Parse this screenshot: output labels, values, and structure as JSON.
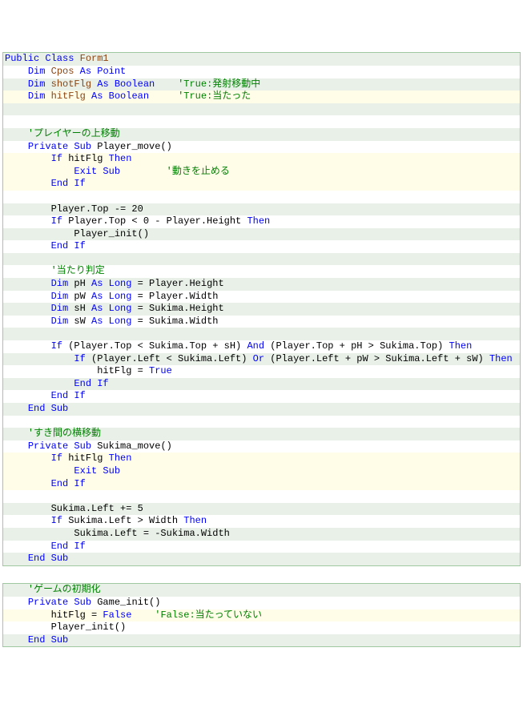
{
  "block1": {
    "lines": [
      {
        "spans": [
          {
            "t": "Public Class",
            "c": "kw"
          },
          {
            "t": " ",
            "c": "ident"
          },
          {
            "t": "Form1",
            "c": "var"
          }
        ]
      },
      {
        "spans": [
          {
            "t": "    ",
            "c": "ident"
          },
          {
            "t": "Dim",
            "c": "kw"
          },
          {
            "t": " ",
            "c": "ident"
          },
          {
            "t": "Cpos",
            "c": "var"
          },
          {
            "t": " ",
            "c": "ident"
          },
          {
            "t": "As",
            "c": "kw"
          },
          {
            "t": " ",
            "c": "ident"
          },
          {
            "t": "Point",
            "c": "kw"
          }
        ]
      },
      {
        "spans": [
          {
            "t": "    ",
            "c": "ident"
          },
          {
            "t": "Dim",
            "c": "kw"
          },
          {
            "t": " ",
            "c": "ident"
          },
          {
            "t": "shotFlg",
            "c": "var"
          },
          {
            "t": " ",
            "c": "ident"
          },
          {
            "t": "As Boolean",
            "c": "kw"
          },
          {
            "t": "    ",
            "c": "ident"
          },
          {
            "t": "'True:発射移動中",
            "c": "comment"
          }
        ]
      },
      {
        "highlight": true,
        "spans": [
          {
            "t": "    ",
            "c": "ident"
          },
          {
            "t": "Dim",
            "c": "kw"
          },
          {
            "t": " ",
            "c": "ident"
          },
          {
            "t": "hitFlg",
            "c": "var"
          },
          {
            "t": " ",
            "c": "ident"
          },
          {
            "t": "As Boolean",
            "c": "kw"
          },
          {
            "t": "     ",
            "c": "ident"
          },
          {
            "t": "'True:当たった",
            "c": "comment"
          }
        ]
      },
      {
        "spans": [
          {
            "t": " ",
            "c": "ident"
          }
        ]
      },
      {
        "spans": [
          {
            "t": " ",
            "c": "ident"
          }
        ]
      },
      {
        "spans": [
          {
            "t": "    ",
            "c": "ident"
          },
          {
            "t": "'プレイヤーの上移動",
            "c": "comment"
          }
        ]
      },
      {
        "spans": [
          {
            "t": "    ",
            "c": "ident"
          },
          {
            "t": "Private Sub",
            "c": "kw"
          },
          {
            "t": " Player_move()",
            "c": "ident"
          }
        ]
      },
      {
        "highlight": true,
        "spans": [
          {
            "t": "        ",
            "c": "ident"
          },
          {
            "t": "If",
            "c": "kw"
          },
          {
            "t": " hitFlg ",
            "c": "ident"
          },
          {
            "t": "Then",
            "c": "kw"
          }
        ]
      },
      {
        "highlight": true,
        "spans": [
          {
            "t": "            ",
            "c": "ident"
          },
          {
            "t": "Exit Sub",
            "c": "kw"
          },
          {
            "t": "        ",
            "c": "ident"
          },
          {
            "t": "'動きを止める",
            "c": "comment"
          }
        ]
      },
      {
        "highlight": true,
        "spans": [
          {
            "t": "        ",
            "c": "ident"
          },
          {
            "t": "End If",
            "c": "kw"
          }
        ]
      },
      {
        "spans": [
          {
            "t": " ",
            "c": "ident"
          }
        ]
      },
      {
        "spans": [
          {
            "t": "        Player.Top -= 20",
            "c": "ident"
          }
        ]
      },
      {
        "spans": [
          {
            "t": "        ",
            "c": "ident"
          },
          {
            "t": "If",
            "c": "kw"
          },
          {
            "t": " Player.Top < 0 - Player.Height ",
            "c": "ident"
          },
          {
            "t": "Then",
            "c": "kw"
          }
        ]
      },
      {
        "spans": [
          {
            "t": "            Player_init()",
            "c": "ident"
          }
        ]
      },
      {
        "spans": [
          {
            "t": "        ",
            "c": "ident"
          },
          {
            "t": "End If",
            "c": "kw"
          }
        ]
      },
      {
        "spans": [
          {
            "t": " ",
            "c": "ident"
          }
        ]
      },
      {
        "spans": [
          {
            "t": "        ",
            "c": "ident"
          },
          {
            "t": "'当たり判定",
            "c": "comment"
          }
        ]
      },
      {
        "spans": [
          {
            "t": "        ",
            "c": "ident"
          },
          {
            "t": "Dim",
            "c": "kw"
          },
          {
            "t": " pH ",
            "c": "ident"
          },
          {
            "t": "As Long",
            "c": "kw"
          },
          {
            "t": " = Player.Height",
            "c": "ident"
          }
        ]
      },
      {
        "spans": [
          {
            "t": "        ",
            "c": "ident"
          },
          {
            "t": "Dim",
            "c": "kw"
          },
          {
            "t": " pW ",
            "c": "ident"
          },
          {
            "t": "As Long",
            "c": "kw"
          },
          {
            "t": " = Player.Width",
            "c": "ident"
          }
        ]
      },
      {
        "spans": [
          {
            "t": "        ",
            "c": "ident"
          },
          {
            "t": "Dim",
            "c": "kw"
          },
          {
            "t": " sH ",
            "c": "ident"
          },
          {
            "t": "As Long",
            "c": "kw"
          },
          {
            "t": " = Sukima.Height",
            "c": "ident"
          }
        ]
      },
      {
        "spans": [
          {
            "t": "        ",
            "c": "ident"
          },
          {
            "t": "Dim",
            "c": "kw"
          },
          {
            "t": " sW ",
            "c": "ident"
          },
          {
            "t": "As Long",
            "c": "kw"
          },
          {
            "t": " = Sukima.Width",
            "c": "ident"
          }
        ]
      },
      {
        "spans": [
          {
            "t": " ",
            "c": "ident"
          }
        ]
      },
      {
        "spans": [
          {
            "t": "        ",
            "c": "ident"
          },
          {
            "t": "If",
            "c": "kw"
          },
          {
            "t": " (Player.Top < Sukima.Top + sH) ",
            "c": "ident"
          },
          {
            "t": "And",
            "c": "kw"
          },
          {
            "t": " (Player.Top + pH > Sukima.Top) ",
            "c": "ident"
          },
          {
            "t": "Then",
            "c": "kw"
          }
        ]
      },
      {
        "spans": [
          {
            "t": "            ",
            "c": "ident"
          },
          {
            "t": "If",
            "c": "kw"
          },
          {
            "t": " (Player.Left < Sukima.Left) ",
            "c": "ident"
          },
          {
            "t": "Or",
            "c": "kw"
          },
          {
            "t": " (Player.Left + pW > Sukima.Left + sW) ",
            "c": "ident"
          },
          {
            "t": "Then",
            "c": "kw"
          }
        ]
      },
      {
        "spans": [
          {
            "t": "                hitFlg = ",
            "c": "ident"
          },
          {
            "t": "True",
            "c": "kw"
          }
        ]
      },
      {
        "spans": [
          {
            "t": "            ",
            "c": "ident"
          },
          {
            "t": "End If",
            "c": "kw"
          }
        ]
      },
      {
        "spans": [
          {
            "t": "        ",
            "c": "ident"
          },
          {
            "t": "End If",
            "c": "kw"
          }
        ]
      },
      {
        "spans": [
          {
            "t": "    ",
            "c": "ident"
          },
          {
            "t": "End Sub",
            "c": "kw"
          }
        ]
      },
      {
        "spans": [
          {
            "t": " ",
            "c": "ident"
          }
        ]
      },
      {
        "spans": [
          {
            "t": "    ",
            "c": "ident"
          },
          {
            "t": "'すき間の横移動",
            "c": "comment"
          }
        ]
      },
      {
        "spans": [
          {
            "t": "    ",
            "c": "ident"
          },
          {
            "t": "Private Sub",
            "c": "kw"
          },
          {
            "t": " Sukima_move()",
            "c": "ident"
          }
        ]
      },
      {
        "highlight": true,
        "spans": [
          {
            "t": "        ",
            "c": "ident"
          },
          {
            "t": "If",
            "c": "kw"
          },
          {
            "t": " hitFlg ",
            "c": "ident"
          },
          {
            "t": "Then",
            "c": "kw"
          }
        ]
      },
      {
        "highlight": true,
        "spans": [
          {
            "t": "            ",
            "c": "ident"
          },
          {
            "t": "Exit Sub",
            "c": "kw"
          }
        ]
      },
      {
        "highlight": true,
        "spans": [
          {
            "t": "        ",
            "c": "ident"
          },
          {
            "t": "End If",
            "c": "kw"
          }
        ]
      },
      {
        "spans": [
          {
            "t": " ",
            "c": "ident"
          }
        ]
      },
      {
        "spans": [
          {
            "t": "        Sukima.Left += 5",
            "c": "ident"
          }
        ]
      },
      {
        "spans": [
          {
            "t": "        ",
            "c": "ident"
          },
          {
            "t": "If",
            "c": "kw"
          },
          {
            "t": " Sukima.Left > Width ",
            "c": "ident"
          },
          {
            "t": "Then",
            "c": "kw"
          }
        ]
      },
      {
        "spans": [
          {
            "t": "            Sukima.Left = -Sukima.Width",
            "c": "ident"
          }
        ]
      },
      {
        "spans": [
          {
            "t": "        ",
            "c": "ident"
          },
          {
            "t": "End If",
            "c": "kw"
          }
        ]
      },
      {
        "spans": [
          {
            "t": "    ",
            "c": "ident"
          },
          {
            "t": "End Sub",
            "c": "kw"
          }
        ]
      }
    ]
  },
  "block2": {
    "lines": [
      {
        "spans": [
          {
            "t": "    ",
            "c": "ident"
          },
          {
            "t": "'ゲームの初期化",
            "c": "comment"
          }
        ]
      },
      {
        "spans": [
          {
            "t": "    ",
            "c": "ident"
          },
          {
            "t": "Private Sub",
            "c": "kw"
          },
          {
            "t": " Game_init()",
            "c": "ident"
          }
        ]
      },
      {
        "highlight": true,
        "spans": [
          {
            "t": "        hitFlg = ",
            "c": "ident"
          },
          {
            "t": "False",
            "c": "kw"
          },
          {
            "t": "    ",
            "c": "ident"
          },
          {
            "t": "'False:当たっていない",
            "c": "comment"
          }
        ]
      },
      {
        "spans": [
          {
            "t": "        Player_init()",
            "c": "ident"
          }
        ]
      },
      {
        "spans": [
          {
            "t": "    ",
            "c": "ident"
          },
          {
            "t": "End Sub",
            "c": "kw"
          }
        ]
      }
    ]
  }
}
